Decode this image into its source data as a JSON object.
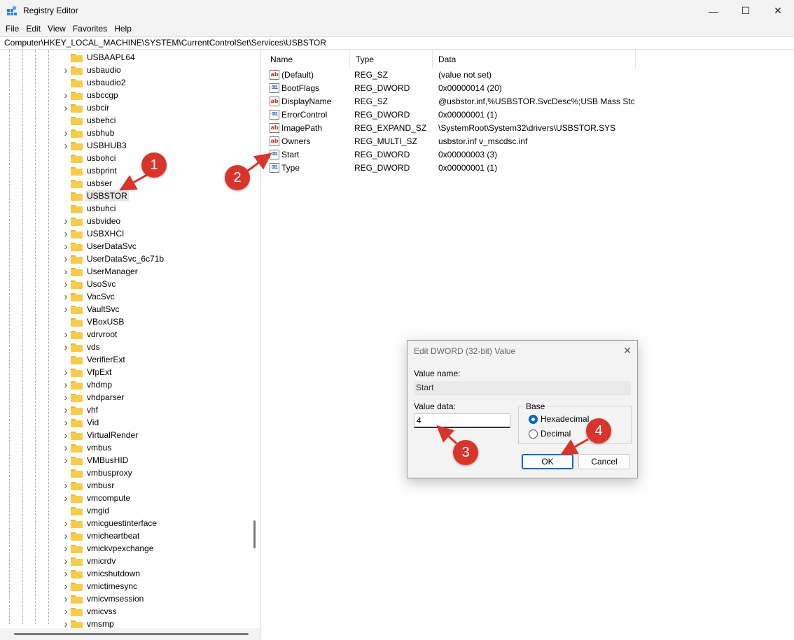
{
  "window": {
    "title": "Registry Editor",
    "minimize": "—",
    "maximize": "☐",
    "close": "✕"
  },
  "menu": [
    "File",
    "Edit",
    "View",
    "Favorites",
    "Help"
  ],
  "address": "Computer\\HKEY_LOCAL_MACHINE\\SYSTEM\\CurrentControlSet\\Services\\USBSTOR",
  "tree": [
    {
      "label": "USBAAPL64",
      "chevron": false
    },
    {
      "label": "usbaudio",
      "chevron": true
    },
    {
      "label": "usbaudio2",
      "chevron": false
    },
    {
      "label": "usbccgp",
      "chevron": true
    },
    {
      "label": "usbcir",
      "chevron": true
    },
    {
      "label": "usbehci",
      "chevron": false
    },
    {
      "label": "usbhub",
      "chevron": true
    },
    {
      "label": "USBHUB3",
      "chevron": true
    },
    {
      "label": "usbohci",
      "chevron": false
    },
    {
      "label": "usbprint",
      "chevron": false
    },
    {
      "label": "usbser",
      "chevron": false
    },
    {
      "label": "USBSTOR",
      "chevron": false,
      "selected": true
    },
    {
      "label": "usbuhci",
      "chevron": false
    },
    {
      "label": "usbvideo",
      "chevron": true
    },
    {
      "label": "USBXHCI",
      "chevron": true
    },
    {
      "label": "UserDataSvc",
      "chevron": true
    },
    {
      "label": "UserDataSvc_6c71b",
      "chevron": true
    },
    {
      "label": "UserManager",
      "chevron": true
    },
    {
      "label": "UsoSvc",
      "chevron": true
    },
    {
      "label": "VacSvc",
      "chevron": true
    },
    {
      "label": "VaultSvc",
      "chevron": true
    },
    {
      "label": "VBoxUSB",
      "chevron": false
    },
    {
      "label": "vdrvroot",
      "chevron": true
    },
    {
      "label": "vds",
      "chevron": true
    },
    {
      "label": "VerifierExt",
      "chevron": false
    },
    {
      "label": "VfpExt",
      "chevron": true
    },
    {
      "label": "vhdmp",
      "chevron": true
    },
    {
      "label": "vhdparser",
      "chevron": true
    },
    {
      "label": "vhf",
      "chevron": true
    },
    {
      "label": "Vid",
      "chevron": true
    },
    {
      "label": "VirtualRender",
      "chevron": true
    },
    {
      "label": "vmbus",
      "chevron": true
    },
    {
      "label": "VMBusHID",
      "chevron": true
    },
    {
      "label": "vmbusproxy",
      "chevron": false
    },
    {
      "label": "vmbusr",
      "chevron": true
    },
    {
      "label": "vmcompute",
      "chevron": true
    },
    {
      "label": "vmgid",
      "chevron": false
    },
    {
      "label": "vmicguestinterface",
      "chevron": true
    },
    {
      "label": "vmicheartbeat",
      "chevron": true
    },
    {
      "label": "vmickvpexchange",
      "chevron": true
    },
    {
      "label": "vmicrdv",
      "chevron": true
    },
    {
      "label": "vmicshutdown",
      "chevron": true
    },
    {
      "label": "vmictimesync",
      "chevron": true
    },
    {
      "label": "vmicvmsession",
      "chevron": true
    },
    {
      "label": "vmicvss",
      "chevron": true
    },
    {
      "label": "vmsmp",
      "chevron": true
    }
  ],
  "columns": {
    "name": "Name",
    "type": "Type",
    "data": "Data"
  },
  "values": [
    {
      "icon": "string-value-icon",
      "glyph": "ab",
      "name": "(Default)",
      "type": "REG_SZ",
      "data": "(value not set)"
    },
    {
      "icon": "binary-value-icon",
      "glyph": "011",
      "name": "BootFlags",
      "type": "REG_DWORD",
      "data": "0x00000014 (20)"
    },
    {
      "icon": "string-value-icon",
      "glyph": "ab",
      "name": "DisplayName",
      "type": "REG_SZ",
      "data": "@usbstor.inf,%USBSTOR.SvcDesc%;USB Mass Stor..."
    },
    {
      "icon": "binary-value-icon",
      "glyph": "011",
      "name": "ErrorControl",
      "type": "REG_DWORD",
      "data": "0x00000001 (1)"
    },
    {
      "icon": "string-value-icon",
      "glyph": "ab",
      "name": "ImagePath",
      "type": "REG_EXPAND_SZ",
      "data": "\\SystemRoot\\System32\\drivers\\USBSTOR.SYS"
    },
    {
      "icon": "string-value-icon",
      "glyph": "ab",
      "name": "Owners",
      "type": "REG_MULTI_SZ",
      "data": "usbstor.inf v_mscdsc.inf"
    },
    {
      "icon": "binary-value-icon",
      "glyph": "011",
      "name": "Start",
      "type": "REG_DWORD",
      "data": "0x00000003 (3)"
    },
    {
      "icon": "binary-value-icon",
      "glyph": "011",
      "name": "Type",
      "type": "REG_DWORD",
      "data": "0x00000001 (1)"
    }
  ],
  "dialog": {
    "title": "Edit DWORD (32-bit) Value",
    "close": "✕",
    "value_name_label": "Value name:",
    "value_name": "Start",
    "value_data_label": "Value data:",
    "value_data": "4",
    "base_label": "Base",
    "hex_label": "Hexadecimal",
    "dec_label": "Decimal",
    "ok_label": "OK",
    "cancel_label": "Cancel"
  },
  "callouts": [
    "1",
    "2",
    "3",
    "4"
  ],
  "colors": {
    "callout": "#d9342b",
    "accent": "#0067c0",
    "folder": "#f7cc4c"
  }
}
